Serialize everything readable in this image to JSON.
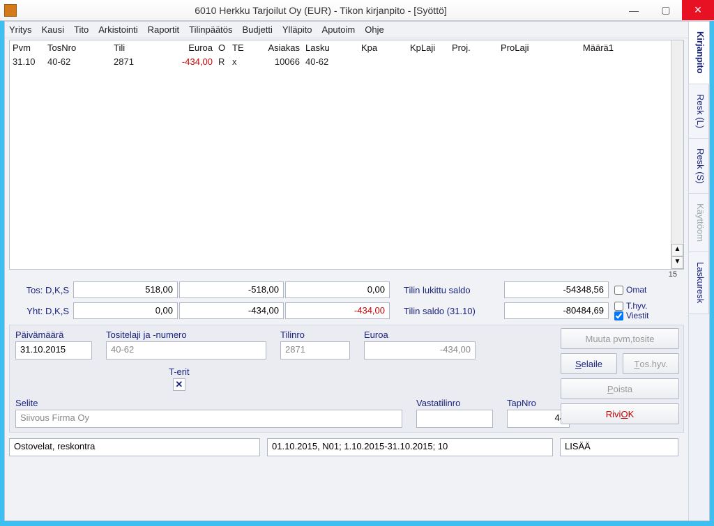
{
  "title": "6010  Herkku Tarjoilut Oy (EUR) - Tikon kirjanpito - [Syöttö]",
  "menu": [
    "Yritys",
    "Kausi",
    "Tito",
    "Arkistointi",
    "Raportit",
    "Tilinpäätös",
    "Budjetti",
    "Ylläpito",
    "Aputoim",
    "Ohje"
  ],
  "grid": {
    "headers": {
      "pvm": "Pvm",
      "tos": "TosNro",
      "tili": "Tili",
      "eur": "Euroa",
      "o": "O",
      "te": "TE",
      "asi": "Asiakas",
      "lasku": "Lasku",
      "kpa": "Kpa",
      "kpl": "KpLaji",
      "proj": "Proj.",
      "prol": "ProLaji",
      "maara": "Määrä1"
    },
    "rows": [
      {
        "pvm": "31.10",
        "tos": "40-62",
        "tili": "2871",
        "eur": "-434,00",
        "o": "R",
        "te": "x",
        "asi": "10066",
        "lasku": "40-62"
      }
    ],
    "rowcount": "15"
  },
  "sums": {
    "tos_label": "Tos: D,K,S",
    "yht_label": "Yht: D,K,S",
    "tos": [
      "518,00",
      "-518,00",
      "0,00"
    ],
    "yht": [
      "0,00",
      "-434,00",
      "-434,00"
    ],
    "tilin_lukittu_label": "Tilin lukittu saldo",
    "tilin_lukittu": "-54348,56",
    "tilin_saldo_label": "Tilin saldo (31.10)",
    "tilin_saldo": "-80484,69",
    "chk_omat": "Omat",
    "chk_thyv": "T.hyv.",
    "chk_viestit": "Viestit"
  },
  "panel": {
    "pvm_label": "Päivämäärä",
    "pvm": "31.10.2015",
    "tosite_label": "Tositelaji ja -numero",
    "tosite": "40-62",
    "tilinro_label": "Tilinro",
    "tilinro": "2871",
    "euroa_label": "Euroa",
    "euroa": "-434,00",
    "terit_label": "T-erit",
    "selite_label": "Selite",
    "selite": "Siivous Firma Oy",
    "vastatilinro_label": "Vastatilinro",
    "vastatilinro": "",
    "tapnro_label": "TapNro",
    "tapnro": "44"
  },
  "buttons": {
    "muuta": "Muuta pvm,tosite",
    "selaile": "elaile",
    "selaile_u": "S",
    "toshyv": "os.hyv.",
    "toshyv_u": "T",
    "poista": "oista",
    "poista_u": "P",
    "riviok_pre": "Rivi ",
    "riviok_u": "O",
    "riviok_post": "K"
  },
  "bottom": {
    "f1": "Ostovelat, reskontra",
    "f2": "01.10.2015, N01; 1.10.2015-31.10.2015; 10",
    "f3": "LISÄÄ"
  },
  "sidetabs": [
    "Kirjanpito",
    "Resk (L)",
    "Resk (S)",
    "Käyttöom",
    "Laskuresk"
  ]
}
